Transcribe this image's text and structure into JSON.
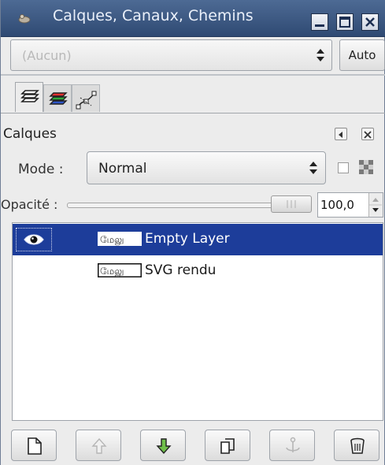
{
  "window": {
    "title": "Calques, Canaux, Chemins",
    "controls": [
      "minimize-icon",
      "maximize-icon",
      "close-icon"
    ]
  },
  "image_selector": {
    "value": "(Aucun)",
    "auto_label": "Auto"
  },
  "tabs": [
    {
      "name": "layers-tab",
      "icon": "layers-icon",
      "active": true
    },
    {
      "name": "channels-tab",
      "icon": "channels-icon",
      "active": false
    },
    {
      "name": "paths-tab",
      "icon": "paths-icon",
      "active": false
    }
  ],
  "panel": {
    "title": "Calques"
  },
  "mode": {
    "label": "Mode :",
    "value": "Normal"
  },
  "opacity": {
    "label": "Opacité :",
    "value": "100,0",
    "fraction": 1.0
  },
  "layers": [
    {
      "name": "Empty Layer",
      "selected": true,
      "visible": true,
      "thumb_text": "மேலு"
    },
    {
      "name": "SVG rendu",
      "selected": false,
      "visible": false,
      "thumb_text": "மேலு"
    }
  ],
  "bottom_buttons": [
    {
      "name": "new-layer-button",
      "icon": "new-document-icon"
    },
    {
      "name": "raise-layer-button",
      "icon": "arrow-up-icon"
    },
    {
      "name": "lower-layer-button",
      "icon": "arrow-down-icon"
    },
    {
      "name": "duplicate-layer-button",
      "icon": "duplicate-icon"
    },
    {
      "name": "anchor-layer-button",
      "icon": "anchor-icon"
    },
    {
      "name": "delete-layer-button",
      "icon": "trash-icon"
    }
  ],
  "colors": {
    "titlebar": "#3b5782",
    "selection": "#1d3d9a"
  }
}
